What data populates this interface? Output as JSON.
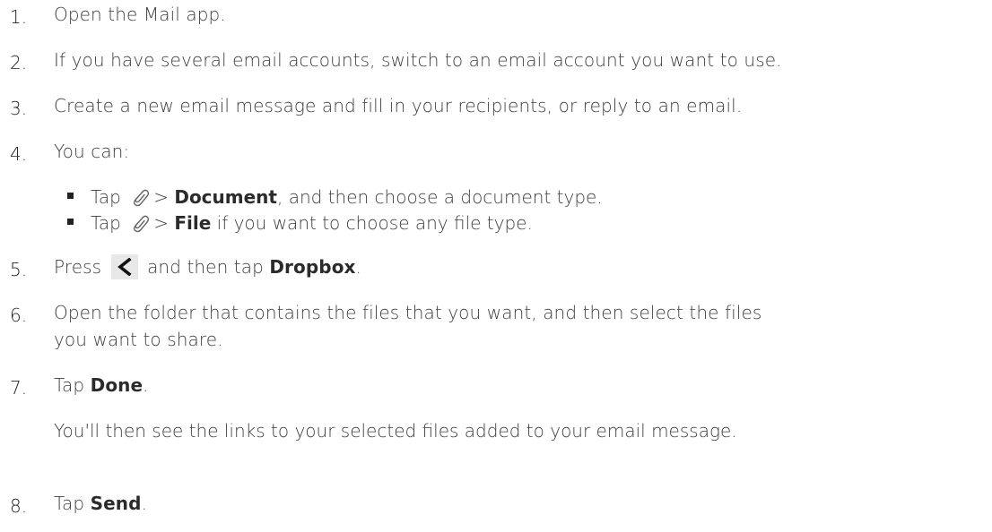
{
  "steps": [
    {
      "number": "1.",
      "text": "Open the Mail app."
    },
    {
      "number": "2.",
      "text": "If you have several email accounts, switch to an email account you want to use."
    },
    {
      "number": "3.",
      "text": "Create a new email message and fill in your recipients, or reply to an email."
    },
    {
      "number": "4.",
      "text": "You can:",
      "bullets": [
        {
          "pre": "Tap",
          "sep": ">",
          "bold": "Document",
          "post": ", and then choose a document type."
        },
        {
          "pre": "Tap",
          "sep": ">",
          "bold": "File",
          "post": " if you want to choose any file type."
        }
      ]
    },
    {
      "number": "5.",
      "pre": "Press",
      "mid": " and then tap ",
      "bold": "Dropbox",
      "post": "."
    },
    {
      "number": "6.",
      "line1": "Open the folder that contains the files that you want, and then select the files",
      "line2": "you want to share."
    },
    {
      "number": "7.",
      "pre": "Tap ",
      "bold": "Done",
      "post": ".",
      "note": "You'll then see the links to your selected files added to your email message."
    },
    {
      "number": "8.",
      "pre": "Tap ",
      "bold": "Send",
      "post": "."
    }
  ],
  "icons": {
    "attach": "paperclip-icon",
    "back": "back-chevron-icon"
  }
}
